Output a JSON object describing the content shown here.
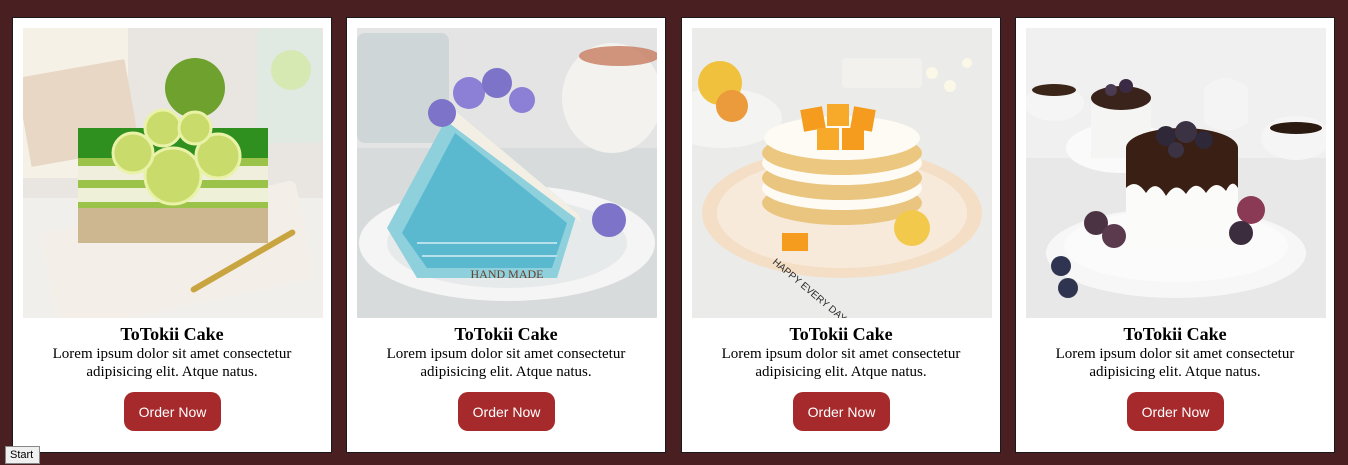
{
  "cards": [
    {
      "title": "ToTokii Cake",
      "description": "Lorem ipsum dolor sit amet consectetur adipisicing elit. Atque natus.",
      "button": "Order Now",
      "image": "lime-jelly-cake"
    },
    {
      "title": "ToTokii Cake",
      "description": "Lorem ipsum dolor sit amet consectetur adipisicing elit. Atque natus.",
      "button": "Order Now",
      "image": "blue-crepe-cake"
    },
    {
      "title": "ToTokii Cake",
      "description": "Lorem ipsum dolor sit amet consectetur adipisicing elit. Atque natus.",
      "button": "Order Now",
      "image": "mango-pancake-stack"
    },
    {
      "title": "ToTokii Cake",
      "description": "Lorem ipsum dolor sit amet consectetur adipisicing elit. Atque natus.",
      "button": "Order Now",
      "image": "chocolate-berry-cake"
    }
  ],
  "taskbar": {
    "start_label": "Start"
  },
  "colors": {
    "background": "#4a1f22",
    "card": "#ffffff",
    "button": "#a6292b",
    "button_text": "#ffffff"
  }
}
